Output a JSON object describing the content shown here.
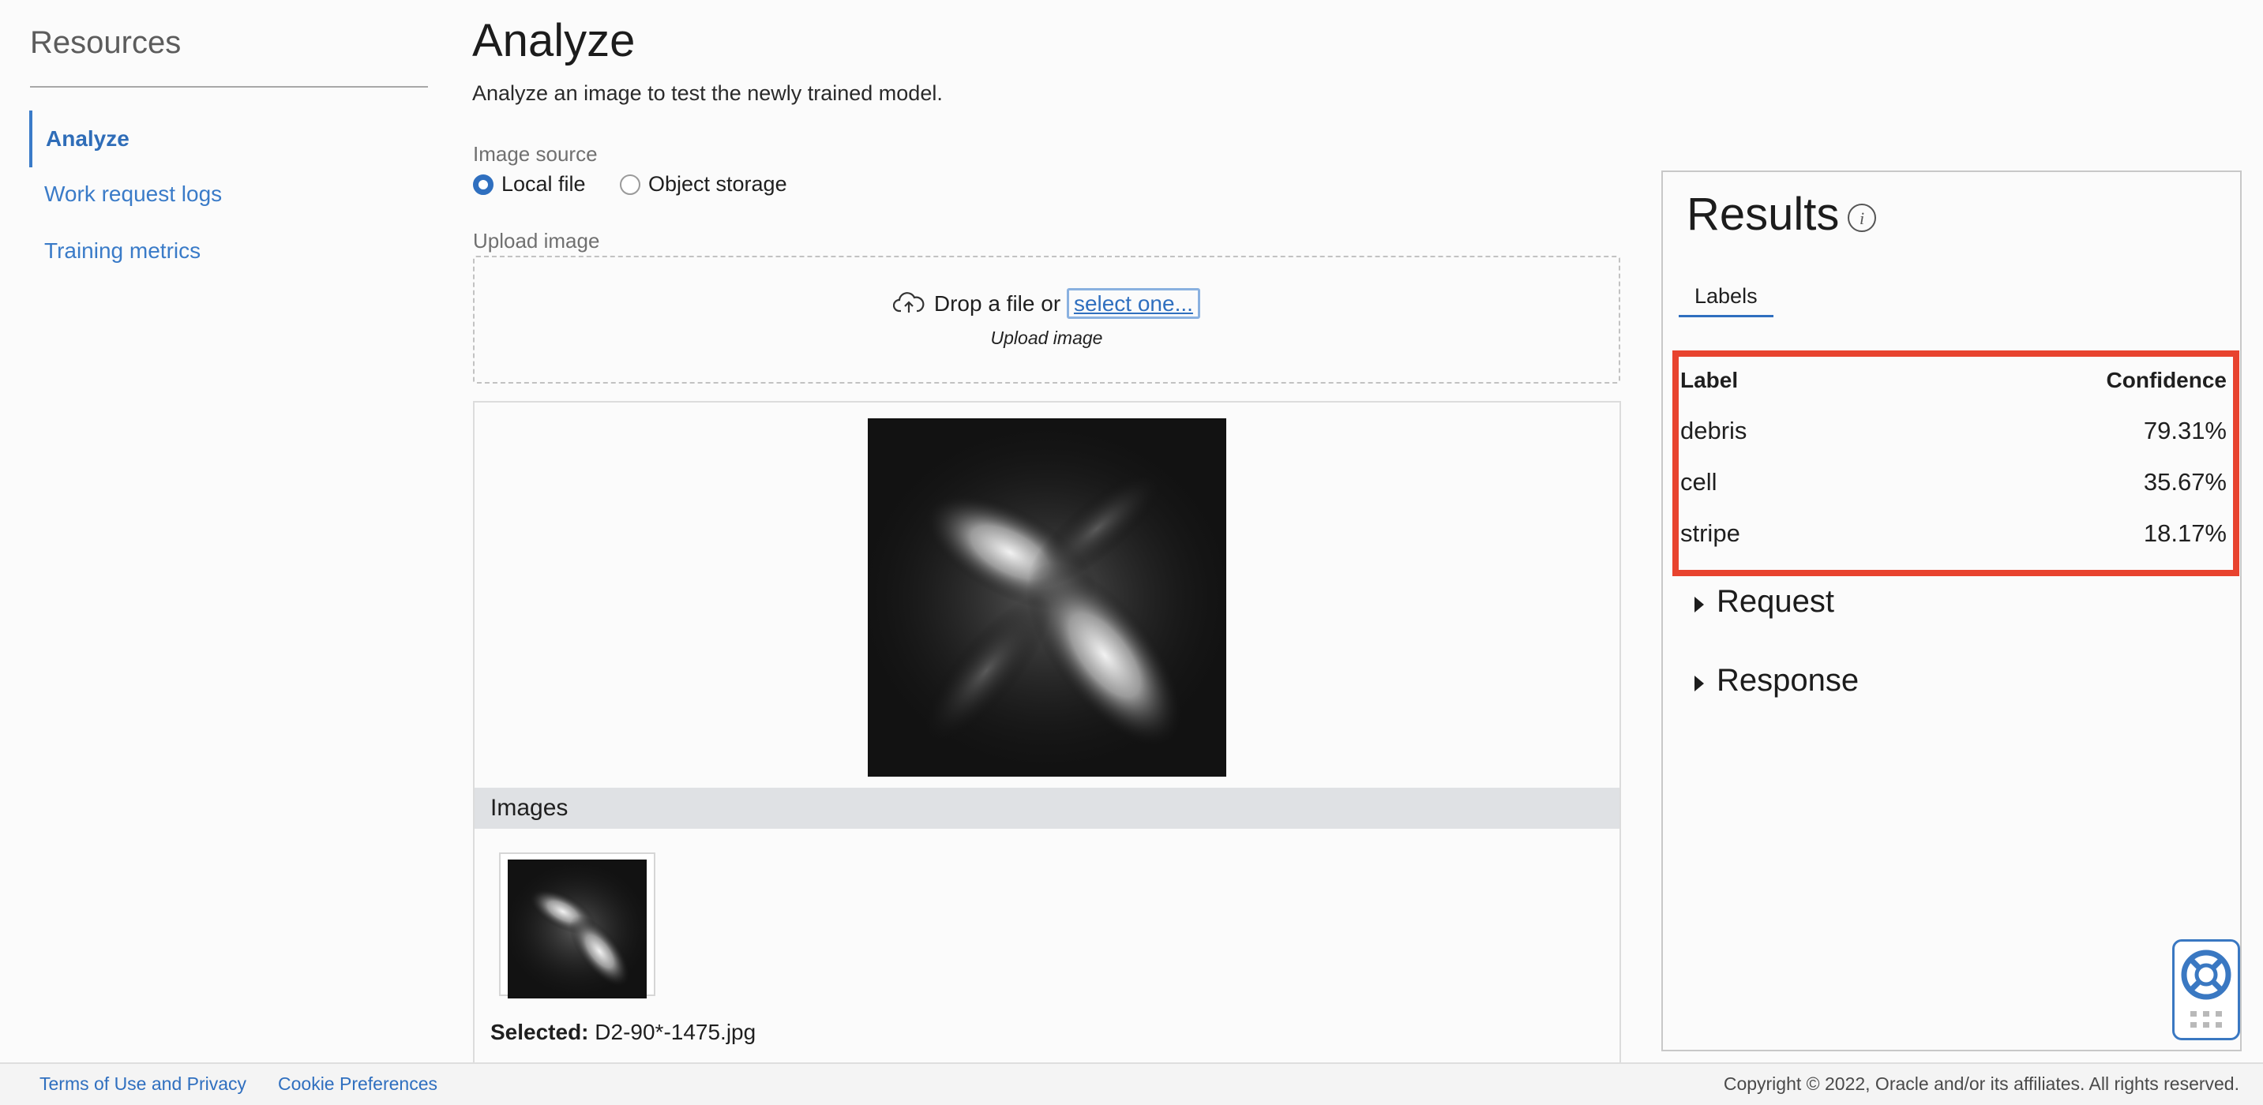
{
  "sidebar": {
    "title": "Resources",
    "items": [
      {
        "label": "Analyze",
        "active": true
      },
      {
        "label": "Work request logs",
        "active": false
      },
      {
        "label": "Training metrics",
        "active": false
      }
    ]
  },
  "main": {
    "title": "Analyze",
    "description": "Analyze an image to test the newly trained model.",
    "image_source": {
      "label": "Image source",
      "options": [
        {
          "label": "Local file",
          "checked": true
        },
        {
          "label": "Object storage",
          "checked": false
        }
      ]
    },
    "upload": {
      "label": "Upload image",
      "drop_text": "Drop a file or",
      "select_link": "select one...",
      "sublabel": "Upload image"
    },
    "images_header": "Images",
    "selected_label": "Selected:",
    "selected_file": "D2-90*-1475.jpg"
  },
  "results": {
    "title": "Results",
    "tab": "Labels",
    "columns": [
      "Label",
      "Confidence"
    ],
    "rows": [
      {
        "label": "debris",
        "confidence": "79.31%"
      },
      {
        "label": "cell",
        "confidence": "35.67%"
      },
      {
        "label": "stripe",
        "confidence": "18.17%"
      }
    ],
    "sections": [
      "Request",
      "Response"
    ]
  },
  "footer": {
    "links": [
      "Terms of Use and Privacy",
      "Cookie Preferences"
    ],
    "copyright": "Copyright © 2022, Oracle and/or its affiliates. All rights reserved."
  },
  "colors": {
    "accent": "#2f6fbf",
    "highlight": "#e8432e"
  },
  "icons": [
    "info-icon",
    "cloud-upload-icon",
    "help-lifebuoy-icon",
    "caret-right-icon"
  ]
}
